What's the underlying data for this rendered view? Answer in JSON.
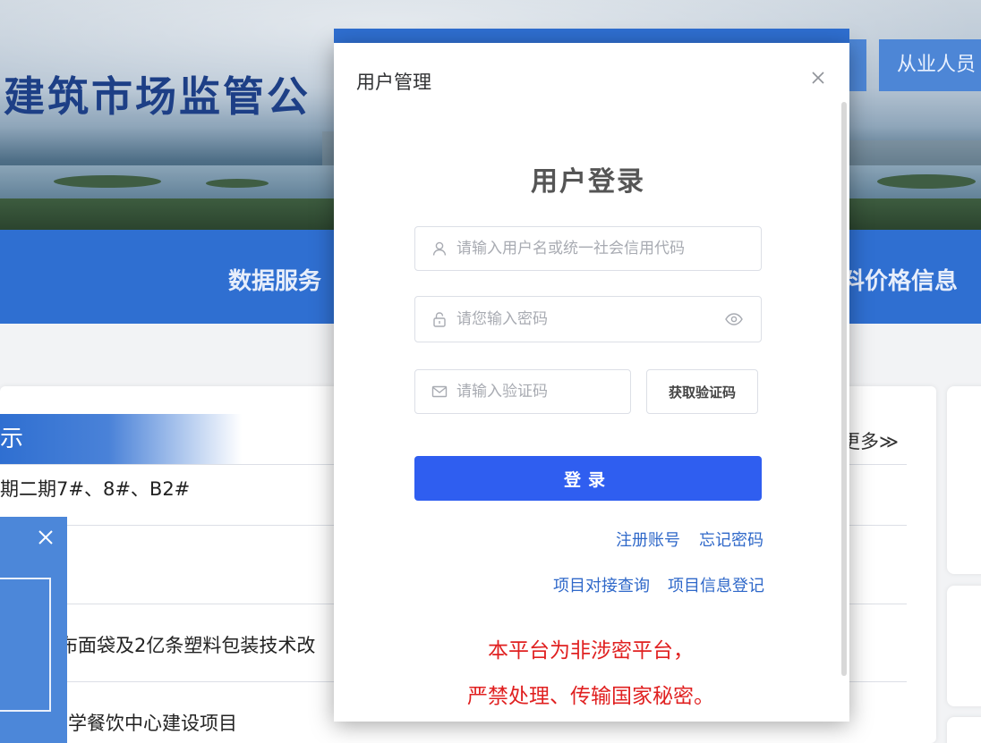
{
  "site": {
    "title": "建筑市场监管公",
    "top_buttons": [
      "",
      "从业人员"
    ],
    "nav": {
      "left_item": "数据服务",
      "right_item": "料价格信息"
    }
  },
  "panel": {
    "heading": "示",
    "more_label": "更多≫",
    "rows": [
      "期二期7#、8#、B2#",
      "",
      "布面袋及2亿条塑料包装技术改",
      "学餐饮中心建设项目"
    ]
  },
  "modal": {
    "title": "用户管理",
    "heading": "用户登录",
    "username": {
      "placeholder": "请输入用户名或统一社会信用代码",
      "value": ""
    },
    "password": {
      "placeholder": "请您输入密码",
      "value": ""
    },
    "captcha": {
      "placeholder": "请输入验证码",
      "value": ""
    },
    "get_code_label": "获取验证码",
    "login_label": "登录",
    "links": {
      "register": "注册账号",
      "forgot": "忘记密码",
      "project_query": "项目对接查询",
      "project_register": "项目信息登记"
    },
    "notice": [
      "本平台为非涉密平台，",
      "严禁处理、传输国家秘密。"
    ]
  },
  "icons": {
    "close": "close-icon",
    "user": "user-icon",
    "lock": "lock-icon",
    "eye": "eye-icon",
    "mail": "mail-icon"
  },
  "colors": {
    "primary": "#2f5ef0",
    "nav_blue": "#2f6fd1",
    "link": "#2f68c9",
    "notice_red": "#e02020"
  }
}
